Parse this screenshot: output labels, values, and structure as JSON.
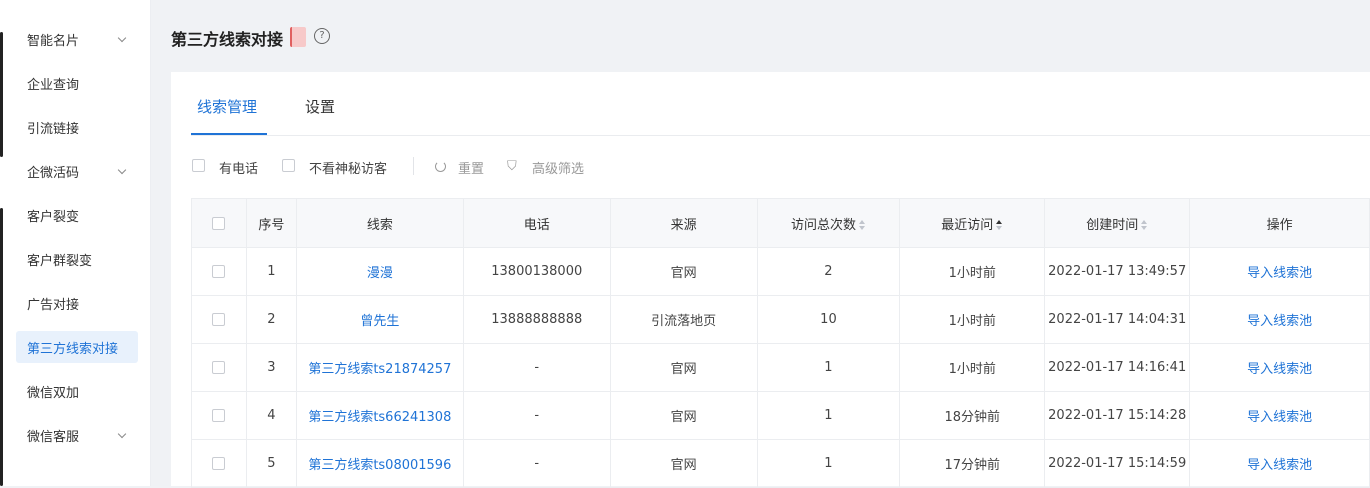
{
  "sidebar": {
    "items": [
      {
        "label": "智能名片",
        "expandable": true
      },
      {
        "label": "企业查询",
        "expandable": false
      },
      {
        "label": "引流链接",
        "expandable": false
      },
      {
        "label": "企微活码",
        "expandable": true
      },
      {
        "label": "客户裂变",
        "expandable": false
      },
      {
        "label": "客户群裂变",
        "expandable": false
      },
      {
        "label": "广告对接",
        "expandable": false
      },
      {
        "label": "第三方线索对接",
        "expandable": false,
        "active": true
      },
      {
        "label": "微信双加",
        "expandable": false
      },
      {
        "label": "微信客服",
        "expandable": true
      }
    ]
  },
  "header": {
    "title": "第三方线索对接",
    "help_icon": "question-circle-icon"
  },
  "tabs": [
    {
      "label": "线索管理",
      "active": true
    },
    {
      "label": "设置",
      "active": false
    }
  ],
  "filters": {
    "has_phone_label": "有电话",
    "hide_mystery_label": "不看神秘访客",
    "reset_label": "重置",
    "advanced_label": "高级筛选"
  },
  "table": {
    "columns": [
      "序号",
      "线索",
      "电话",
      "来源",
      "访问总次数",
      "最近访问",
      "创建时间",
      "操作"
    ],
    "sort": {
      "访问总次数": "none",
      "最近访问": "asc",
      "创建时间": "none"
    },
    "rows": [
      {
        "no": "1",
        "lead": "漫漫",
        "phone": "13800138000",
        "source": "官网",
        "visits": "2",
        "last_visit": "1小时前",
        "created": "2022-01-17 13:49:57",
        "action": "导入线索池"
      },
      {
        "no": "2",
        "lead": "曾先生",
        "phone": "13888888888",
        "source": "引流落地页",
        "visits": "10",
        "last_visit": "1小时前",
        "created": "2022-01-17 14:04:31",
        "action": "导入线索池"
      },
      {
        "no": "3",
        "lead": "第三方线索ts21874257",
        "phone": "-",
        "source": "官网",
        "visits": "1",
        "last_visit": "1小时前",
        "created": "2022-01-17 14:16:41",
        "action": "导入线索池"
      },
      {
        "no": "4",
        "lead": "第三方线索ts66241308",
        "phone": "-",
        "source": "官网",
        "visits": "1",
        "last_visit": "18分钟前",
        "created": "2022-01-17 15:14:28",
        "action": "导入线索池"
      },
      {
        "no": "5",
        "lead": "第三方线索ts08001596",
        "phone": "-",
        "source": "官网",
        "visits": "1",
        "last_visit": "17分钟前",
        "created": "2022-01-17 15:14:59",
        "action": "导入线索池"
      }
    ]
  },
  "colors": {
    "accent": "#1f73d6",
    "active_bg": "#e8f1fc"
  }
}
